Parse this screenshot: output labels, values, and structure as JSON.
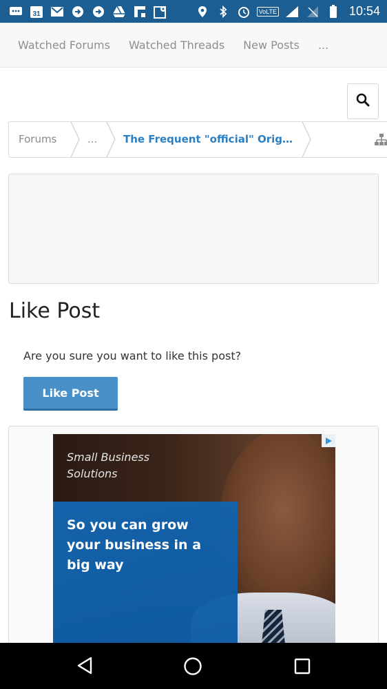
{
  "status_bar": {
    "time": "10:54",
    "calendar_day": "31",
    "volte_label": "VoLTE",
    "lte_label": "LTE",
    "icons": [
      "chat-icon",
      "calendar-icon",
      "gmail-icon",
      "sync-icon",
      "sync-icon",
      "drive-icon",
      "flipboard-icon",
      "maps-icon",
      "location-icon",
      "bluetooth-icon",
      "alarm-icon",
      "signal-icon",
      "battery-icon"
    ]
  },
  "top_nav": {
    "items": [
      "Watched Forums",
      "Watched Threads",
      "New Posts",
      "..."
    ]
  },
  "search": {
    "icon": "search-icon"
  },
  "breadcrumb": {
    "forums": "Forums",
    "ellipsis": "...",
    "thread": "The Frequent \"official\" Origi..."
  },
  "page": {
    "heading": "Like Post",
    "question": "Are you sure you want to like this post?",
    "like_button": "Like Post"
  },
  "ad": {
    "top_text": "Small Business Solutions",
    "main_text": "So you can grow your business in a big way"
  },
  "colors": {
    "status_bar": "#1c5e91",
    "link": "#2b7fc3",
    "button": "#4a90c8"
  }
}
